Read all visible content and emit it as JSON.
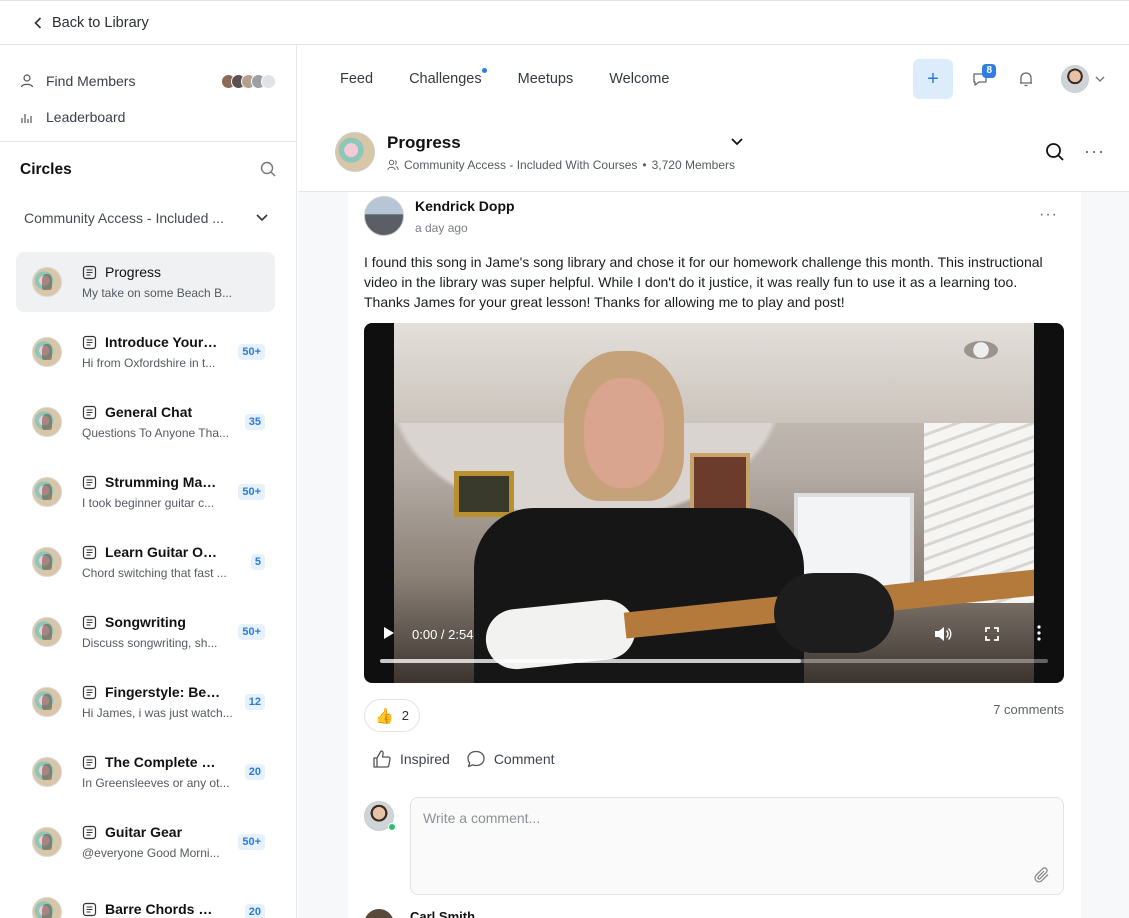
{
  "topbar": {
    "back_label": "Back to Library"
  },
  "sidebar": {
    "nav": [
      {
        "label": "Find Members"
      },
      {
        "label": "Leaderboard"
      }
    ],
    "member_avatar_colors": [
      "#8a6b55",
      "#5a5250",
      "#b5a08e",
      "#9aa0a6",
      "#dfe2e6"
    ],
    "circles_title": "Circles",
    "space_group": "Community Access - Included ...",
    "circles": [
      {
        "name": "Progress",
        "preview": "My take on some Beach B...",
        "badge": ""
      },
      {
        "name": "Introduce Yours...",
        "preview": "Hi from Oxfordshire in t...",
        "badge": "50+"
      },
      {
        "name": "General Chat",
        "preview": "Questions To Anyone Tha...",
        "badge": "35"
      },
      {
        "name": "Strumming Mad...",
        "preview": "I took beginner guitar c...",
        "badge": "50+"
      },
      {
        "name": "Learn Guitar Once...",
        "preview": "Chord switching that fast ...",
        "badge": "5"
      },
      {
        "name": "Songwriting",
        "preview": "Discuss songwriting, sh...",
        "badge": "50+"
      },
      {
        "name": "Fingerstyle: Begin...",
        "preview": "Hi James, i was just watch...",
        "badge": "12"
      },
      {
        "name": "The Complete Le...",
        "preview": "In Greensleeves or any ot...",
        "badge": "20"
      },
      {
        "name": "Guitar Gear",
        "preview": "@everyone Good Morni...",
        "badge": "50+"
      },
      {
        "name": "Barre Chords Ma...",
        "preview": "",
        "badge": "20"
      }
    ]
  },
  "header": {
    "tabs": [
      {
        "label": "Feed"
      },
      {
        "label": "Challenges"
      },
      {
        "label": "Meetups"
      },
      {
        "label": "Welcome"
      }
    ],
    "plus_label": "+",
    "messages_badge": "8"
  },
  "space": {
    "title": "Progress",
    "group": "Community Access - Included With Courses",
    "separator": "•",
    "members": "3,720 Members"
  },
  "post": {
    "author": "Kendrick Dopp",
    "time": "a day ago",
    "body": "I found this song in Jame's song library and chose it for our homework challenge this month.  This instructional video in the library was super helpful.  While I don't do it justice, it was really fun to use it as a learning too.  Thanks James for your great lesson!  Thanks for allowing me to play and post!",
    "video": {
      "time": "0:00 / 2:54",
      "progress": 0.63
    },
    "reaction_emoji": "👍",
    "reaction_count": "2",
    "comments_count": "7 comments",
    "actions": {
      "inspired": "Inspired",
      "comment": "Comment"
    },
    "comment_placeholder": "Write a comment..."
  },
  "next_comment": {
    "author": "Carl Smith"
  }
}
